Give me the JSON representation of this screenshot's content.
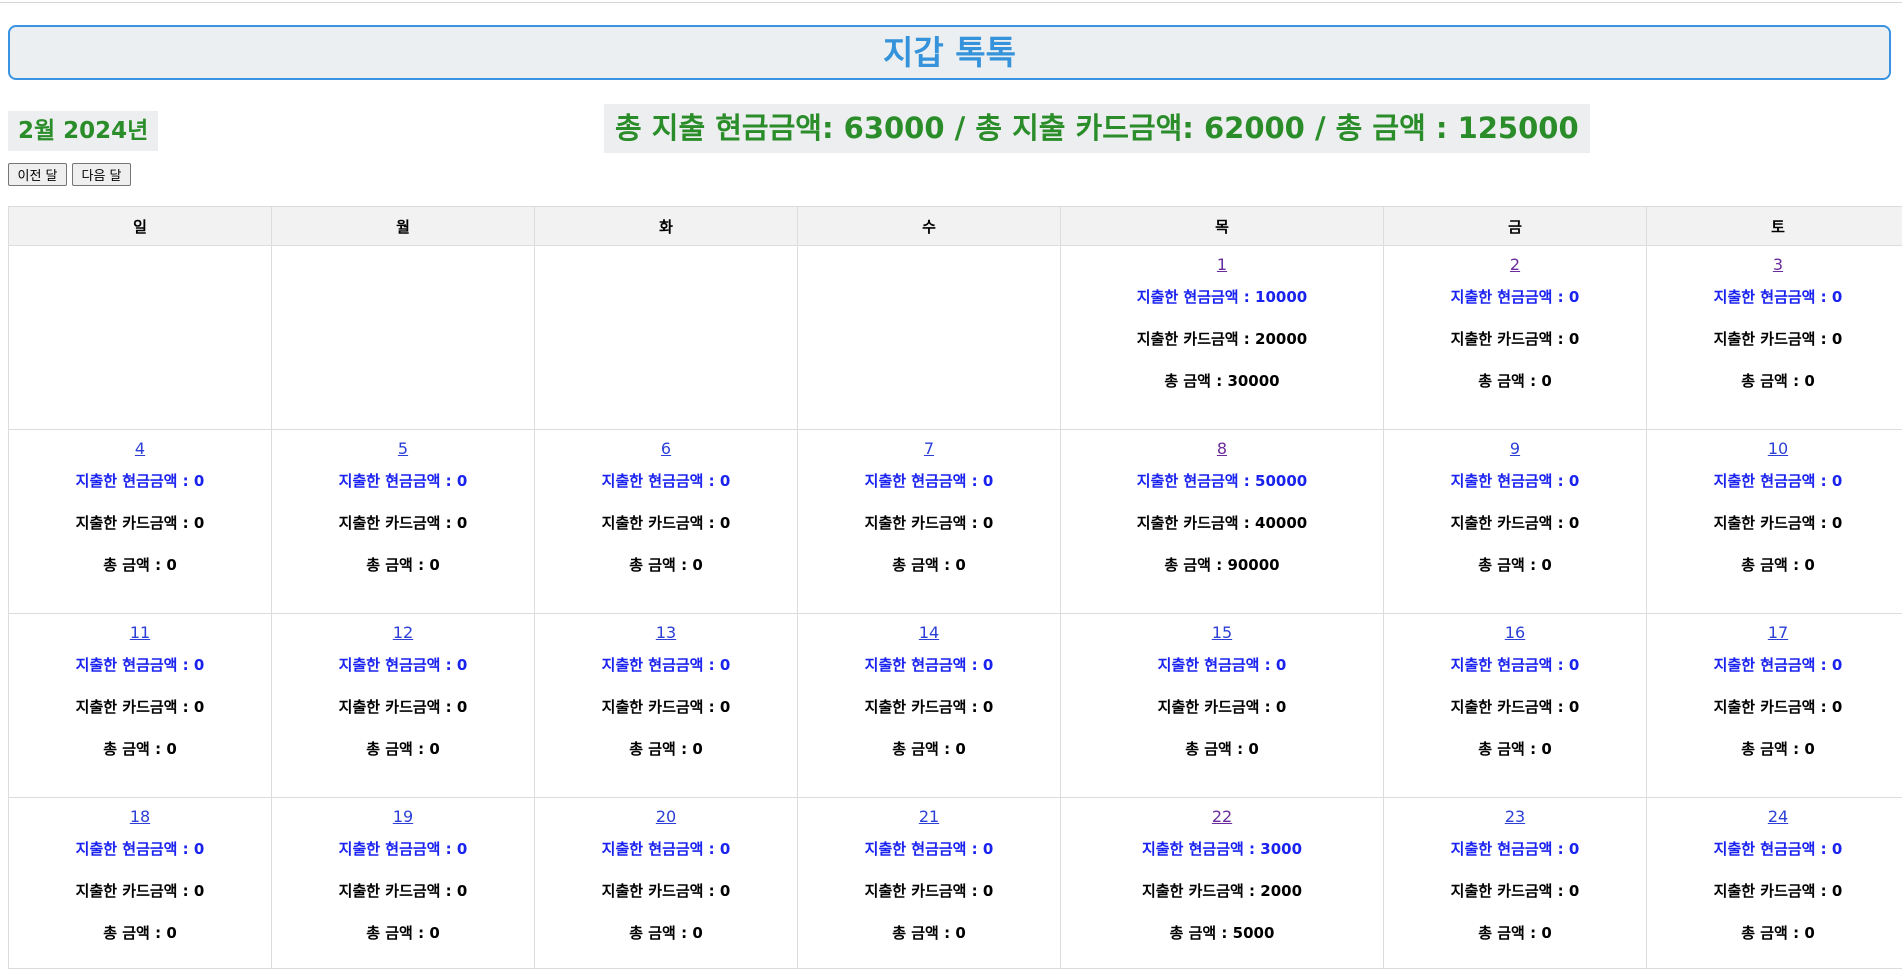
{
  "header": {
    "title": "지갑 톡톡"
  },
  "month_label": "2월 2024년",
  "totals_text": "총 지출 현금금액: 63000 / 총 지출 카드금액: 62000 / 총 금액 : 125000",
  "nav": {
    "prev_label": "이전 달",
    "next_label": "다음 달"
  },
  "weekdays": [
    "일",
    "월",
    "화",
    "수",
    "목",
    "금",
    "토"
  ],
  "labels": {
    "cash": "지출한 현금금액 : ",
    "card": "지출한 카드금액 : ",
    "total": "총 금액 : "
  },
  "weeks": [
    [
      null,
      null,
      null,
      null,
      {
        "day": "1",
        "cash": "10000",
        "card": "20000",
        "total": "30000"
      },
      {
        "day": "2",
        "cash": "0",
        "card": "0",
        "total": "0"
      },
      {
        "day": "3",
        "cash": "0",
        "card": "0",
        "total": "0"
      }
    ],
    [
      {
        "day": "4",
        "cash": "0",
        "card": "0",
        "total": "0"
      },
      {
        "day": "5",
        "cash": "0",
        "card": "0",
        "total": "0"
      },
      {
        "day": "6",
        "cash": "0",
        "card": "0",
        "total": "0"
      },
      {
        "day": "7",
        "cash": "0",
        "card": "0",
        "total": "0"
      },
      {
        "day": "8",
        "cash": "50000",
        "card": "40000",
        "total": "90000"
      },
      {
        "day": "9",
        "cash": "0",
        "card": "0",
        "total": "0"
      },
      {
        "day": "10",
        "cash": "0",
        "card": "0",
        "total": "0"
      }
    ],
    [
      {
        "day": "11",
        "cash": "0",
        "card": "0",
        "total": "0"
      },
      {
        "day": "12",
        "cash": "0",
        "card": "0",
        "total": "0"
      },
      {
        "day": "13",
        "cash": "0",
        "card": "0",
        "total": "0"
      },
      {
        "day": "14",
        "cash": "0",
        "card": "0",
        "total": "0"
      },
      {
        "day": "15",
        "cash": "0",
        "card": "0",
        "total": "0"
      },
      {
        "day": "16",
        "cash": "0",
        "card": "0",
        "total": "0"
      },
      {
        "day": "17",
        "cash": "0",
        "card": "0",
        "total": "0"
      }
    ],
    [
      {
        "day": "18",
        "cash": "0",
        "card": "0",
        "total": "0"
      },
      {
        "day": "19",
        "cash": "0",
        "card": "0",
        "total": "0"
      },
      {
        "day": "20",
        "cash": "0",
        "card": "0",
        "total": "0"
      },
      {
        "day": "21",
        "cash": "0",
        "card": "0",
        "total": "0"
      },
      {
        "day": "22",
        "cash": "3000",
        "card": "2000",
        "total": "5000"
      },
      {
        "day": "23",
        "cash": "0",
        "card": "0",
        "total": "0"
      },
      {
        "day": "24",
        "cash": "0",
        "card": "0",
        "total": "0"
      }
    ]
  ]
}
